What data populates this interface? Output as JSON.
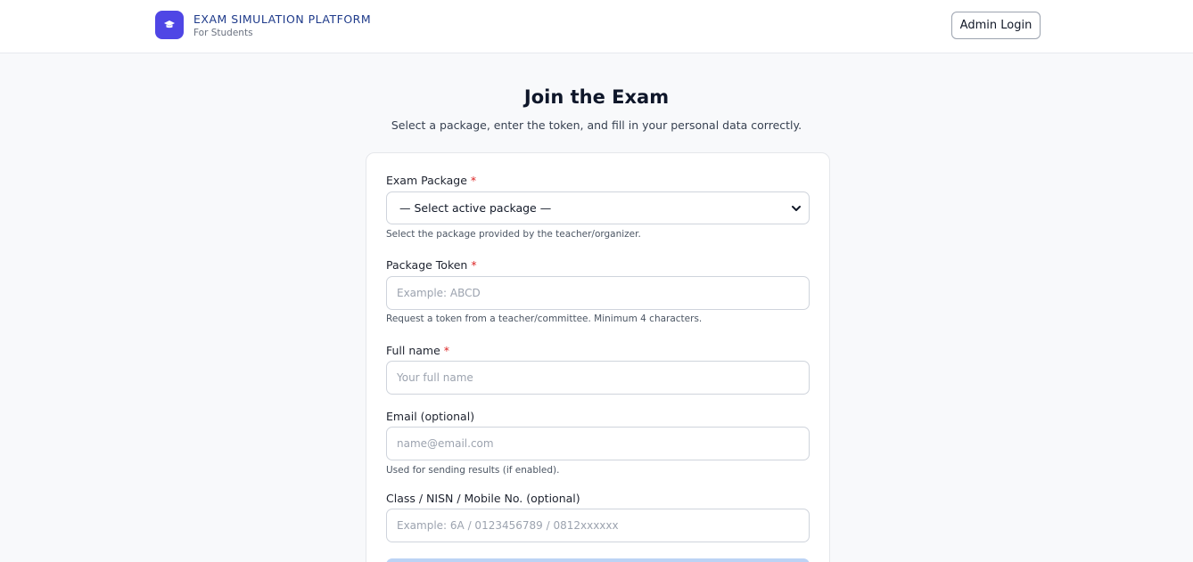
{
  "header": {
    "brand_title": "EXAM SIMULATION PLATFORM",
    "brand_subtitle": "For Students",
    "admin_login": "Admin Login"
  },
  "main": {
    "title": "Join the Exam",
    "subtitle": "Select a package, enter the token, and fill in your personal data correctly."
  },
  "form": {
    "package": {
      "label": "Exam Package",
      "required_mark": "*",
      "selected": "— Select active package —",
      "help": "Select the package provided by the teacher/organizer."
    },
    "token": {
      "label": "Package Token",
      "required_mark": "*",
      "placeholder": "Example: ABCD",
      "help": "Request a token from a teacher/committee. Minimum 4 characters."
    },
    "full_name": {
      "label": "Full name",
      "required_mark": "*",
      "placeholder": "Your full name"
    },
    "email": {
      "label": "Email (optional)",
      "placeholder": "name@email.com",
      "help": "Used for sending results (if enabled)."
    },
    "class_info": {
      "label": "Class / NISN / Mobile No. (optional)",
      "placeholder": "Example: 6A / 0123456789 / 0812xxxxxx"
    }
  },
  "colors": {
    "brand_accent": "#4f46e5",
    "brand_text": "#1e3a8a",
    "required": "#dc2626",
    "submit_disabled": "#bcd3f5"
  },
  "icons": {
    "brand": "graduation-cap-icon",
    "select": "chevron-down-icon"
  }
}
